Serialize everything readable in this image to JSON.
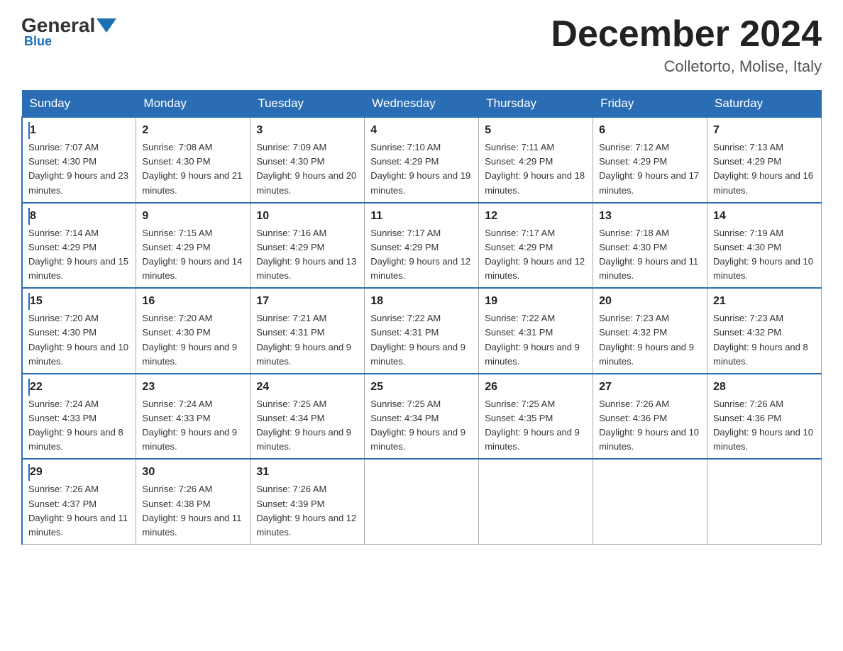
{
  "header": {
    "logo_general": "General",
    "logo_blue": "Blue",
    "month_title": "December 2024",
    "subtitle": "Colletorto, Molise, Italy"
  },
  "days_of_week": [
    "Sunday",
    "Monday",
    "Tuesday",
    "Wednesday",
    "Thursday",
    "Friday",
    "Saturday"
  ],
  "weeks": [
    [
      {
        "num": "1",
        "sunrise": "7:07 AM",
        "sunset": "4:30 PM",
        "daylight": "9 hours and 23 minutes."
      },
      {
        "num": "2",
        "sunrise": "7:08 AM",
        "sunset": "4:30 PM",
        "daylight": "9 hours and 21 minutes."
      },
      {
        "num": "3",
        "sunrise": "7:09 AM",
        "sunset": "4:30 PM",
        "daylight": "9 hours and 20 minutes."
      },
      {
        "num": "4",
        "sunrise": "7:10 AM",
        "sunset": "4:29 PM",
        "daylight": "9 hours and 19 minutes."
      },
      {
        "num": "5",
        "sunrise": "7:11 AM",
        "sunset": "4:29 PM",
        "daylight": "9 hours and 18 minutes."
      },
      {
        "num": "6",
        "sunrise": "7:12 AM",
        "sunset": "4:29 PM",
        "daylight": "9 hours and 17 minutes."
      },
      {
        "num": "7",
        "sunrise": "7:13 AM",
        "sunset": "4:29 PM",
        "daylight": "9 hours and 16 minutes."
      }
    ],
    [
      {
        "num": "8",
        "sunrise": "7:14 AM",
        "sunset": "4:29 PM",
        "daylight": "9 hours and 15 minutes."
      },
      {
        "num": "9",
        "sunrise": "7:15 AM",
        "sunset": "4:29 PM",
        "daylight": "9 hours and 14 minutes."
      },
      {
        "num": "10",
        "sunrise": "7:16 AM",
        "sunset": "4:29 PM",
        "daylight": "9 hours and 13 minutes."
      },
      {
        "num": "11",
        "sunrise": "7:17 AM",
        "sunset": "4:29 PM",
        "daylight": "9 hours and 12 minutes."
      },
      {
        "num": "12",
        "sunrise": "7:17 AM",
        "sunset": "4:29 PM",
        "daylight": "9 hours and 12 minutes."
      },
      {
        "num": "13",
        "sunrise": "7:18 AM",
        "sunset": "4:30 PM",
        "daylight": "9 hours and 11 minutes."
      },
      {
        "num": "14",
        "sunrise": "7:19 AM",
        "sunset": "4:30 PM",
        "daylight": "9 hours and 10 minutes."
      }
    ],
    [
      {
        "num": "15",
        "sunrise": "7:20 AM",
        "sunset": "4:30 PM",
        "daylight": "9 hours and 10 minutes."
      },
      {
        "num": "16",
        "sunrise": "7:20 AM",
        "sunset": "4:30 PM",
        "daylight": "9 hours and 9 minutes."
      },
      {
        "num": "17",
        "sunrise": "7:21 AM",
        "sunset": "4:31 PM",
        "daylight": "9 hours and 9 minutes."
      },
      {
        "num": "18",
        "sunrise": "7:22 AM",
        "sunset": "4:31 PM",
        "daylight": "9 hours and 9 minutes."
      },
      {
        "num": "19",
        "sunrise": "7:22 AM",
        "sunset": "4:31 PM",
        "daylight": "9 hours and 9 minutes."
      },
      {
        "num": "20",
        "sunrise": "7:23 AM",
        "sunset": "4:32 PM",
        "daylight": "9 hours and 9 minutes."
      },
      {
        "num": "21",
        "sunrise": "7:23 AM",
        "sunset": "4:32 PM",
        "daylight": "9 hours and 8 minutes."
      }
    ],
    [
      {
        "num": "22",
        "sunrise": "7:24 AM",
        "sunset": "4:33 PM",
        "daylight": "9 hours and 8 minutes."
      },
      {
        "num": "23",
        "sunrise": "7:24 AM",
        "sunset": "4:33 PM",
        "daylight": "9 hours and 9 minutes."
      },
      {
        "num": "24",
        "sunrise": "7:25 AM",
        "sunset": "4:34 PM",
        "daylight": "9 hours and 9 minutes."
      },
      {
        "num": "25",
        "sunrise": "7:25 AM",
        "sunset": "4:34 PM",
        "daylight": "9 hours and 9 minutes."
      },
      {
        "num": "26",
        "sunrise": "7:25 AM",
        "sunset": "4:35 PM",
        "daylight": "9 hours and 9 minutes."
      },
      {
        "num": "27",
        "sunrise": "7:26 AM",
        "sunset": "4:36 PM",
        "daylight": "9 hours and 10 minutes."
      },
      {
        "num": "28",
        "sunrise": "7:26 AM",
        "sunset": "4:36 PM",
        "daylight": "9 hours and 10 minutes."
      }
    ],
    [
      {
        "num": "29",
        "sunrise": "7:26 AM",
        "sunset": "4:37 PM",
        "daylight": "9 hours and 11 minutes."
      },
      {
        "num": "30",
        "sunrise": "7:26 AM",
        "sunset": "4:38 PM",
        "daylight": "9 hours and 11 minutes."
      },
      {
        "num": "31",
        "sunrise": "7:26 AM",
        "sunset": "4:39 PM",
        "daylight": "9 hours and 12 minutes."
      },
      null,
      null,
      null,
      null
    ]
  ]
}
